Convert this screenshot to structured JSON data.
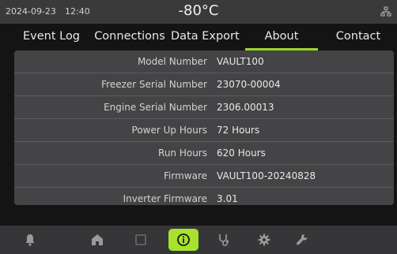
{
  "status": {
    "date": "2024-09-23",
    "time": "12:40",
    "temperature": "-80°C",
    "network_icon": "network-icon"
  },
  "tabs": [
    {
      "label": "Event Log"
    },
    {
      "label": "Connections"
    },
    {
      "label": "Data Export"
    },
    {
      "label": "About",
      "active": true
    },
    {
      "label": "Contact"
    }
  ],
  "about": {
    "rows": [
      {
        "label": "Model Number",
        "value": "VAULT100"
      },
      {
        "label": "Freezer Serial Number",
        "value": "23070-00004"
      },
      {
        "label": "Engine Serial Number",
        "value": "2306.00013"
      },
      {
        "label": "Power Up Hours",
        "value": "72 Hours"
      },
      {
        "label": "Run Hours",
        "value": "620 Hours"
      },
      {
        "label": "Firmware",
        "value": "VAULT100-20240828"
      },
      {
        "label": "Inverter Firmware",
        "value": "3.01"
      }
    ]
  },
  "bottom_nav": [
    {
      "icon": "bell-icon"
    },
    {
      "icon": "home-icon"
    },
    {
      "icon": "square-icon"
    },
    {
      "icon": "info-icon",
      "active": true
    },
    {
      "icon": "stethoscope-icon"
    },
    {
      "icon": "gear-icon"
    },
    {
      "icon": "wrench-icon"
    }
  ],
  "colors": {
    "accent": "#a6e22e",
    "background": "#141414",
    "panel": "#444446",
    "bar": "#3a3a3a"
  }
}
